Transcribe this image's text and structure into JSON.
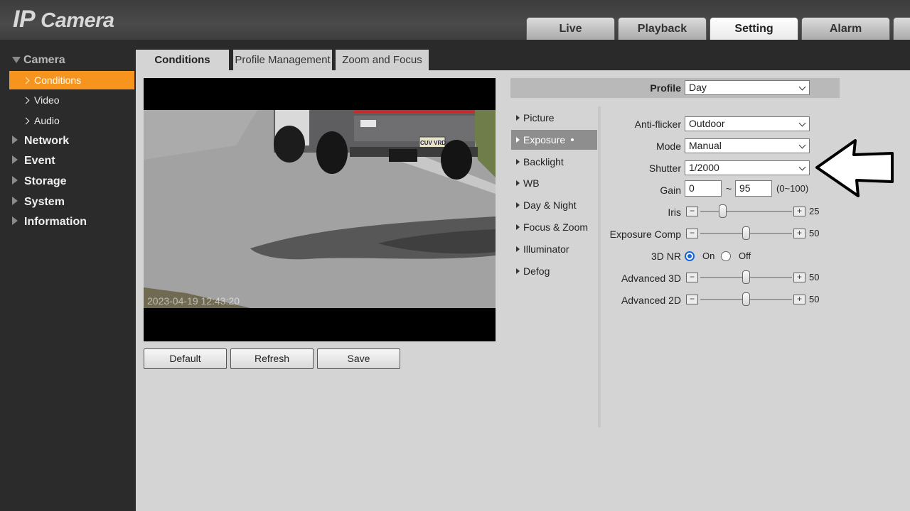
{
  "header": {
    "logo_ip": "IP",
    "logo_camera": "Camera"
  },
  "main_tabs": [
    "Live",
    "Playback",
    "Setting",
    "Alarm"
  ],
  "sidebar": {
    "camera": "Camera",
    "items": [
      "Conditions",
      "Video",
      "Audio"
    ],
    "sections": [
      "Network",
      "Event",
      "Storage",
      "System",
      "Information"
    ]
  },
  "sub_tabs": [
    "Conditions",
    "Profile Management",
    "Zoom and Focus"
  ],
  "video": {
    "timestamp": "2023-04-19 12:43:20",
    "plate": "CUV VRD"
  },
  "buttons": {
    "default": "Default",
    "refresh": "Refresh",
    "save": "Save"
  },
  "profile": {
    "label": "Profile",
    "value": "Day"
  },
  "submenu": [
    "Picture",
    "Exposure",
    "Backlight",
    "WB",
    "Day & Night",
    "Focus & Zoom",
    "Illuminator",
    "Defog"
  ],
  "settings": {
    "anti_flicker": {
      "label": "Anti-flicker",
      "value": "Outdoor"
    },
    "mode": {
      "label": "Mode",
      "value": "Manual"
    },
    "shutter": {
      "label": "Shutter",
      "value": "1/2000"
    },
    "gain": {
      "label": "Gain",
      "min": "0",
      "sep": "~",
      "max": "95",
      "range": "(0~100)"
    },
    "iris": {
      "label": "Iris",
      "value": "25",
      "frac": 0.25
    },
    "exposure_comp": {
      "label": "Exposure Comp",
      "value": "50",
      "frac": 0.5
    },
    "nr3d": {
      "label": "3D NR",
      "on": "On",
      "off": "Off",
      "selected": "On"
    },
    "advanced_3d": {
      "label": "Advanced 3D",
      "value": "50",
      "frac": 0.5
    },
    "advanced_2d": {
      "label": "Advanced 2D",
      "value": "50",
      "frac": 0.5
    }
  },
  "slider_minus": "−",
  "slider_plus": "+",
  "colors": {
    "accent": "#f7941d",
    "header": "#404040",
    "sidebar": "#2b2b2b",
    "radio": "#1565d8"
  }
}
